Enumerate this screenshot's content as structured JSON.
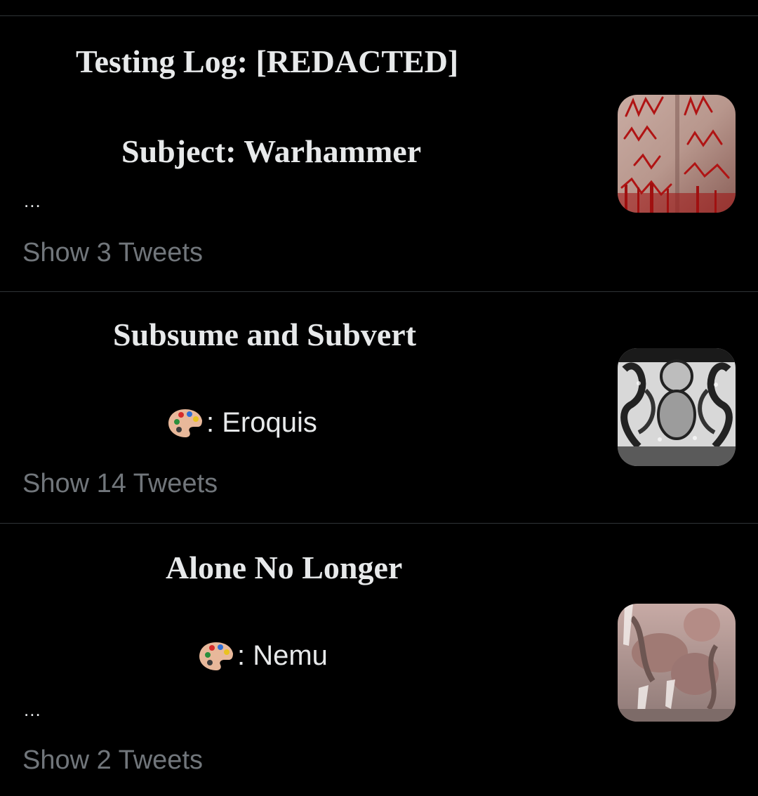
{
  "threads": [
    {
      "title": "Testing Log: [REDACTED]",
      "subtitle": "Subject: Warhammer",
      "ellipsis": "...",
      "show_label": "Show 3 Tweets",
      "thumbnail_alt": "red scrawled text artwork"
    },
    {
      "title": "Subsume and Subvert",
      "credit_icon": "palette-icon",
      "credit": ": Eroquis",
      "show_label": "Show 14 Tweets",
      "thumbnail_alt": "black and white tentacle artwork"
    },
    {
      "title": "Alone No Longer",
      "credit_icon": "palette-icon",
      "credit": ": Nemu",
      "ellipsis": "...",
      "show_label": "Show 2 Tweets",
      "thumbnail_alt": "pale flesh-toned artwork"
    }
  ],
  "colors": {
    "background": "#000000",
    "text": "#e7e9ea",
    "muted": "#71767b",
    "divider": "#2f3336"
  }
}
